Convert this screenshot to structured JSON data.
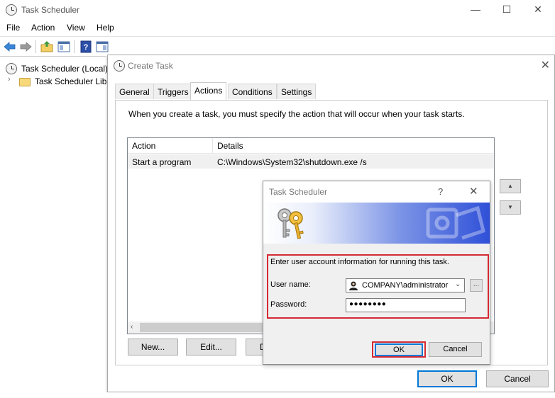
{
  "main_window": {
    "title": "Task Scheduler",
    "controls": {
      "minimize": "—",
      "maximize": "☐",
      "close": "✕"
    }
  },
  "menu": [
    "File",
    "Action",
    "View",
    "Help"
  ],
  "tree": {
    "root": "Task Scheduler (Local)",
    "child": "Task Scheduler Libra"
  },
  "create_task": {
    "title": "Create Task",
    "close": "✕",
    "tabs": [
      "General",
      "Triggers",
      "Actions",
      "Conditions",
      "Settings"
    ],
    "active_tab": "Actions",
    "instruction": "When you create a task, you must specify the action that will occur when your task starts.",
    "columns": [
      "Action",
      "Details"
    ],
    "rows": [
      {
        "action": "Start a program",
        "details": "C:\\Windows\\System32\\shutdown.exe /s"
      }
    ],
    "buttons": {
      "new": "New...",
      "edit": "Edit...",
      "delete_partial": "D"
    },
    "move_up": "▲",
    "move_down": "▼",
    "ok": "OK",
    "cancel": "Cancel"
  },
  "credentials_dialog": {
    "title": "Task Scheduler",
    "help": "?",
    "close": "✕",
    "prompt": "Enter user account information for running this task.",
    "user_label": "User name:",
    "user_value": "COMPANY\\administrator",
    "password_label": "Password:",
    "password_value": "●●●●●●●●",
    "browse": "...",
    "ok": "OK",
    "cancel": "Cancel"
  },
  "colors": {
    "highlight_red": "#d42a33",
    "focus_blue": "#0078d7",
    "banner_blue": "#2f50d8"
  }
}
